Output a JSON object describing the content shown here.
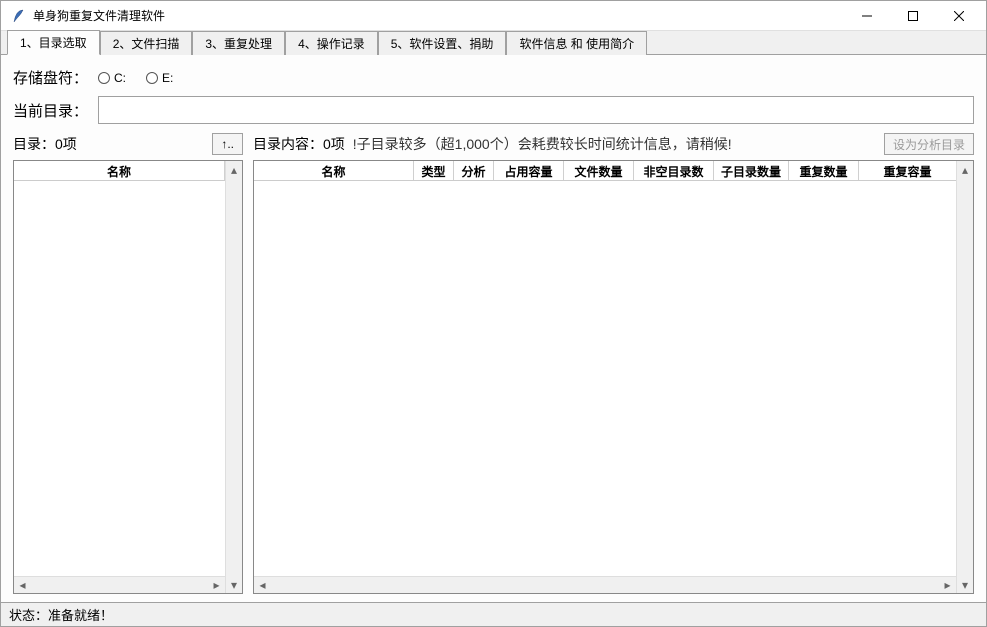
{
  "window": {
    "title": "单身狗重复文件清理软件"
  },
  "tabs": [
    "1、目录选取",
    "2、文件扫描",
    "3、重复处理",
    "4、操作记录",
    "5、软件设置、捐助",
    "软件信息 和 使用简介"
  ],
  "storage": {
    "label": "存储盘符：",
    "drives": [
      "C:",
      "E:"
    ]
  },
  "currentDir": {
    "label": "当前目录：",
    "value": ""
  },
  "leftPane": {
    "header": "目录：0项",
    "upBtn": "↑..",
    "columns": [
      "名称"
    ]
  },
  "rightPane": {
    "header": "目录内容：0项",
    "warning": "!子目录较多（超1,000个）会耗费较长时间统计信息，请稍候!",
    "analyzeBtn": "设为分析目录",
    "columns": [
      "名称",
      "类型",
      "分析",
      "占用容量",
      "文件数量",
      "非空目录数",
      "子目录数量",
      "重复数量",
      "重复容量"
    ]
  },
  "status": {
    "text": "状态：准备就绪！"
  }
}
